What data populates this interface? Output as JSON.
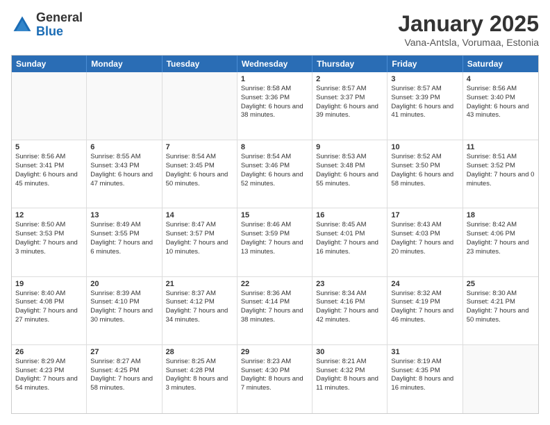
{
  "header": {
    "logo_general": "General",
    "logo_blue": "Blue",
    "month_title": "January 2025",
    "location": "Vana-Antsla, Vorumaa, Estonia"
  },
  "weekdays": [
    "Sunday",
    "Monday",
    "Tuesday",
    "Wednesday",
    "Thursday",
    "Friday",
    "Saturday"
  ],
  "rows": [
    [
      {
        "day": "",
        "text": "",
        "empty": true
      },
      {
        "day": "",
        "text": "",
        "empty": true
      },
      {
        "day": "",
        "text": "",
        "empty": true
      },
      {
        "day": "1",
        "text": "Sunrise: 8:58 AM\nSunset: 3:36 PM\nDaylight: 6 hours and 38 minutes."
      },
      {
        "day": "2",
        "text": "Sunrise: 8:57 AM\nSunset: 3:37 PM\nDaylight: 6 hours and 39 minutes."
      },
      {
        "day": "3",
        "text": "Sunrise: 8:57 AM\nSunset: 3:39 PM\nDaylight: 6 hours and 41 minutes."
      },
      {
        "day": "4",
        "text": "Sunrise: 8:56 AM\nSunset: 3:40 PM\nDaylight: 6 hours and 43 minutes."
      }
    ],
    [
      {
        "day": "5",
        "text": "Sunrise: 8:56 AM\nSunset: 3:41 PM\nDaylight: 6 hours and 45 minutes."
      },
      {
        "day": "6",
        "text": "Sunrise: 8:55 AM\nSunset: 3:43 PM\nDaylight: 6 hours and 47 minutes."
      },
      {
        "day": "7",
        "text": "Sunrise: 8:54 AM\nSunset: 3:45 PM\nDaylight: 6 hours and 50 minutes."
      },
      {
        "day": "8",
        "text": "Sunrise: 8:54 AM\nSunset: 3:46 PM\nDaylight: 6 hours and 52 minutes."
      },
      {
        "day": "9",
        "text": "Sunrise: 8:53 AM\nSunset: 3:48 PM\nDaylight: 6 hours and 55 minutes."
      },
      {
        "day": "10",
        "text": "Sunrise: 8:52 AM\nSunset: 3:50 PM\nDaylight: 6 hours and 58 minutes."
      },
      {
        "day": "11",
        "text": "Sunrise: 8:51 AM\nSunset: 3:52 PM\nDaylight: 7 hours and 0 minutes."
      }
    ],
    [
      {
        "day": "12",
        "text": "Sunrise: 8:50 AM\nSunset: 3:53 PM\nDaylight: 7 hours and 3 minutes."
      },
      {
        "day": "13",
        "text": "Sunrise: 8:49 AM\nSunset: 3:55 PM\nDaylight: 7 hours and 6 minutes."
      },
      {
        "day": "14",
        "text": "Sunrise: 8:47 AM\nSunset: 3:57 PM\nDaylight: 7 hours and 10 minutes."
      },
      {
        "day": "15",
        "text": "Sunrise: 8:46 AM\nSunset: 3:59 PM\nDaylight: 7 hours and 13 minutes."
      },
      {
        "day": "16",
        "text": "Sunrise: 8:45 AM\nSunset: 4:01 PM\nDaylight: 7 hours and 16 minutes."
      },
      {
        "day": "17",
        "text": "Sunrise: 8:43 AM\nSunset: 4:03 PM\nDaylight: 7 hours and 20 minutes."
      },
      {
        "day": "18",
        "text": "Sunrise: 8:42 AM\nSunset: 4:06 PM\nDaylight: 7 hours and 23 minutes."
      }
    ],
    [
      {
        "day": "19",
        "text": "Sunrise: 8:40 AM\nSunset: 4:08 PM\nDaylight: 7 hours and 27 minutes."
      },
      {
        "day": "20",
        "text": "Sunrise: 8:39 AM\nSunset: 4:10 PM\nDaylight: 7 hours and 30 minutes."
      },
      {
        "day": "21",
        "text": "Sunrise: 8:37 AM\nSunset: 4:12 PM\nDaylight: 7 hours and 34 minutes."
      },
      {
        "day": "22",
        "text": "Sunrise: 8:36 AM\nSunset: 4:14 PM\nDaylight: 7 hours and 38 minutes."
      },
      {
        "day": "23",
        "text": "Sunrise: 8:34 AM\nSunset: 4:16 PM\nDaylight: 7 hours and 42 minutes."
      },
      {
        "day": "24",
        "text": "Sunrise: 8:32 AM\nSunset: 4:19 PM\nDaylight: 7 hours and 46 minutes."
      },
      {
        "day": "25",
        "text": "Sunrise: 8:30 AM\nSunset: 4:21 PM\nDaylight: 7 hours and 50 minutes."
      }
    ],
    [
      {
        "day": "26",
        "text": "Sunrise: 8:29 AM\nSunset: 4:23 PM\nDaylight: 7 hours and 54 minutes."
      },
      {
        "day": "27",
        "text": "Sunrise: 8:27 AM\nSunset: 4:25 PM\nDaylight: 7 hours and 58 minutes."
      },
      {
        "day": "28",
        "text": "Sunrise: 8:25 AM\nSunset: 4:28 PM\nDaylight: 8 hours and 3 minutes."
      },
      {
        "day": "29",
        "text": "Sunrise: 8:23 AM\nSunset: 4:30 PM\nDaylight: 8 hours and 7 minutes."
      },
      {
        "day": "30",
        "text": "Sunrise: 8:21 AM\nSunset: 4:32 PM\nDaylight: 8 hours and 11 minutes."
      },
      {
        "day": "31",
        "text": "Sunrise: 8:19 AM\nSunset: 4:35 PM\nDaylight: 8 hours and 16 minutes."
      },
      {
        "day": "",
        "text": "",
        "empty": true
      }
    ]
  ]
}
